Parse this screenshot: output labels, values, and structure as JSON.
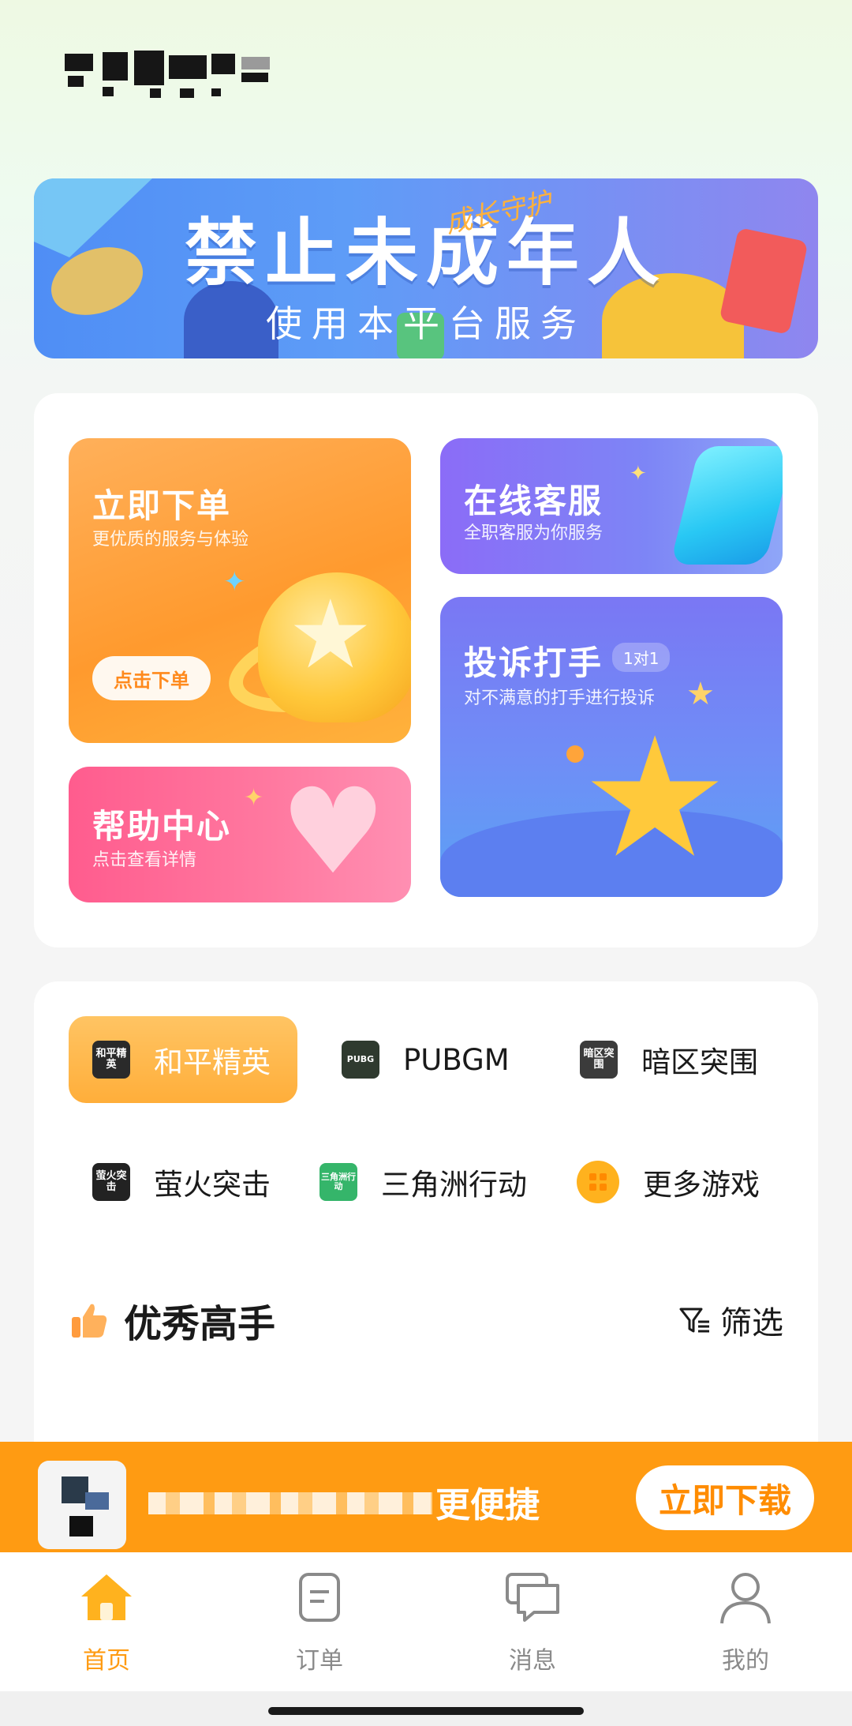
{
  "banner": {
    "title": "禁止未成年人",
    "subtitle": "使用本平台服务",
    "handwriting": "成长守护"
  },
  "services": {
    "order": {
      "title": "立即下单",
      "subtitle": "更优质的服务与体验",
      "button": "点击下单"
    },
    "customer_service": {
      "title": "在线客服",
      "subtitle": "全职客服为你服务"
    },
    "complaint": {
      "title": "投诉打手",
      "badge": "1对1",
      "subtitle": "对不满意的打手进行投诉"
    },
    "help": {
      "title": "帮助中心",
      "subtitle": "点击查看详情"
    }
  },
  "games": [
    {
      "name": "和平精英",
      "icon_text": "和平精英",
      "icon": "heping-icon",
      "color": "#2a2a2a",
      "active": true
    },
    {
      "name": "PUBGM",
      "icon_text": "PUBG",
      "icon": "pubgm-icon",
      "color": "#2f3a2f",
      "active": false
    },
    {
      "name": "暗区突围",
      "icon_text": "暗区突围",
      "icon": "anqu-icon",
      "color": "#3b3b3b",
      "active": false
    },
    {
      "name": "萤火突击",
      "icon_text": "萤火突击",
      "icon": "yinghuo-icon",
      "color": "#222222",
      "active": false
    },
    {
      "name": "三角洲行动",
      "icon_text": "三角洲行动",
      "icon": "sanjiaozhou-icon",
      "color": "#35b56a",
      "active": false
    },
    {
      "name": "更多游戏",
      "icon_text": "",
      "icon": "more-grid-icon",
      "color": "#ffb21e",
      "active": false
    }
  ],
  "section": {
    "title": "优秀高手",
    "filter": "筛选"
  },
  "download": {
    "text": "更便捷",
    "button": "立即下载"
  },
  "nav": [
    {
      "label": "首页",
      "icon": "home-icon",
      "active": true
    },
    {
      "label": "订单",
      "icon": "order-icon",
      "active": false
    },
    {
      "label": "消息",
      "icon": "message-icon",
      "active": false
    },
    {
      "label": "我的",
      "icon": "profile-icon",
      "active": false
    }
  ],
  "colors": {
    "accent": "#ff9b12",
    "nav_active": "#ffb21e",
    "nav_inactive": "#8a8a8a"
  }
}
